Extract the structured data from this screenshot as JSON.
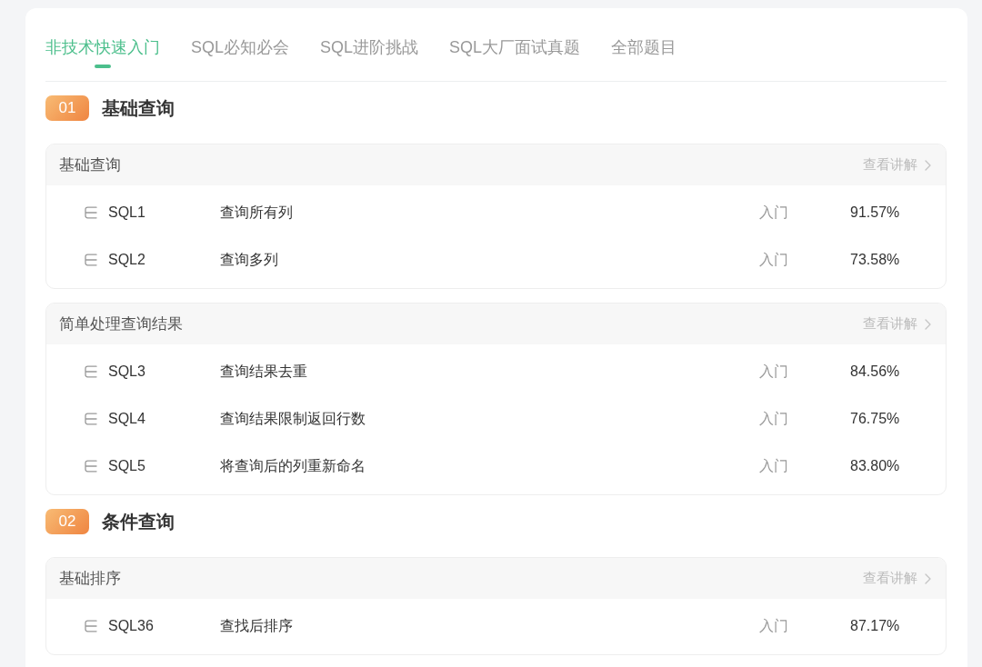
{
  "tabs": [
    {
      "label": "非技术快速入门",
      "selected": true
    },
    {
      "label": "SQL必知必会",
      "selected": false
    },
    {
      "label": "SQL进阶挑战",
      "selected": false
    },
    {
      "label": "SQL大厂面试真题",
      "selected": false
    },
    {
      "label": "全部题目",
      "selected": false
    }
  ],
  "sections": [
    {
      "number": "01",
      "title": "基础查询",
      "groups": [
        {
          "title": "基础查询",
          "link": "查看讲解",
          "problems": [
            {
              "id": "SQL1",
              "title": "查询所有列",
              "difficulty": "入门",
              "pass_rate": "91.57%"
            },
            {
              "id": "SQL2",
              "title": "查询多列",
              "difficulty": "入门",
              "pass_rate": "73.58%"
            }
          ]
        },
        {
          "title": "简单处理查询结果",
          "link": "查看讲解",
          "problems": [
            {
              "id": "SQL3",
              "title": "查询结果去重",
              "difficulty": "入门",
              "pass_rate": "84.56%"
            },
            {
              "id": "SQL4",
              "title": "查询结果限制返回行数",
              "difficulty": "入门",
              "pass_rate": "76.75%"
            },
            {
              "id": "SQL5",
              "title": "将查询后的列重新命名",
              "difficulty": "入门",
              "pass_rate": "83.80%"
            }
          ]
        }
      ]
    },
    {
      "number": "02",
      "title": "条件查询",
      "groups": [
        {
          "title": "基础排序",
          "link": "查看讲解",
          "problems": [
            {
              "id": "SQL36",
              "title": "查找后排序",
              "difficulty": "入门",
              "pass_rate": "87.17%"
            }
          ]
        }
      ]
    }
  ]
}
